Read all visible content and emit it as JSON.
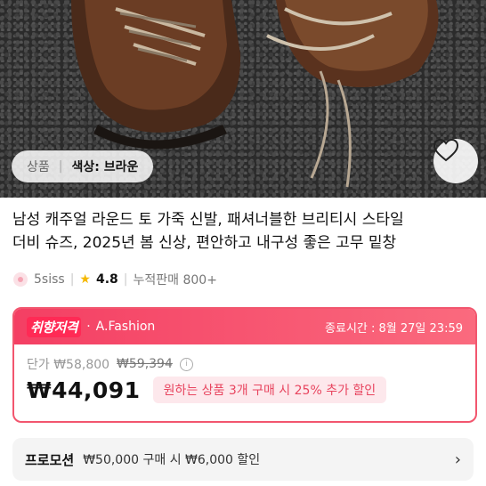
{
  "product_image": {
    "attr_label": "상품",
    "attr_value": "색상: 브라운"
  },
  "title_lines": [
    "남성 캐주얼 라운드 토 가죽 신발, 패셔너블한 브리티시 스타일",
    "더비 슈즈, 2025년 봄 신상, 편안하고 내구성 좋은 고무 밑창"
  ],
  "seller": {
    "name": "5siss",
    "rating": "4.8",
    "sales": "누적판매 800+"
  },
  "deal": {
    "badge": "취향저격",
    "brand": "A.Fashion",
    "end_time": "종료시간 : 8월 27일 23:59",
    "unit_price": "단가 ₩58,800",
    "original_price": "₩59,394",
    "price": "₩44,091",
    "multi_offer": "원하는 상품 3개 구매 시 25% 추가 할인"
  },
  "promotion": {
    "label": "프로모션",
    "text": "₩50,000 구매 시 ₩6,000 할인"
  },
  "colors": {
    "accent": "#f2566e",
    "accent_bg": "#fde8ec"
  }
}
